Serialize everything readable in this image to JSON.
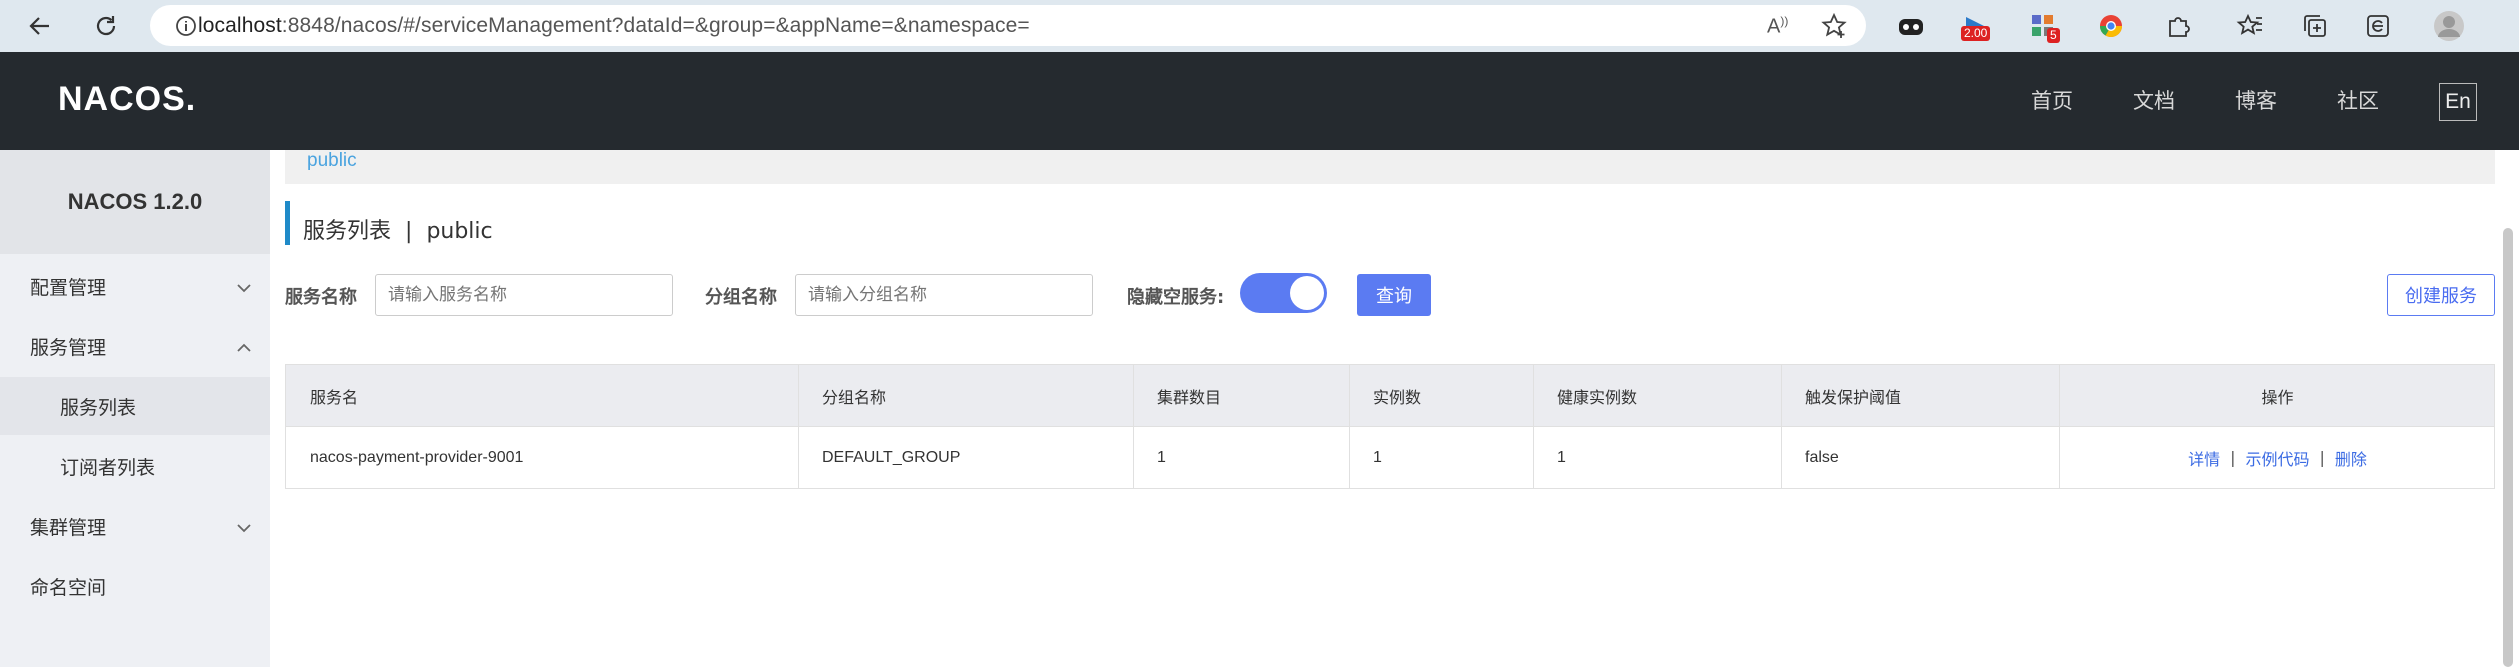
{
  "browser": {
    "url_host": "localhost",
    "url_rest": ":8848/nacos/#/serviceManagement?dataId=&group=&appName=&namespace=",
    "extensions": [
      {
        "name": "copilot-icon"
      },
      {
        "name": "extension-badge-icon",
        "badge": "2.00"
      },
      {
        "name": "extension-grid-icon",
        "badge": "5"
      },
      {
        "name": "chrome-like-icon"
      },
      {
        "name": "puzzle-icon"
      }
    ]
  },
  "header": {
    "logo": "NACOS.",
    "nav": [
      "首页",
      "文档",
      "博客",
      "社区"
    ],
    "lang": "En"
  },
  "sidebar": {
    "version": "NACOS 1.2.0",
    "items": [
      {
        "label": "配置管理",
        "chevron": "down"
      },
      {
        "label": "服务管理",
        "chevron": "up"
      },
      {
        "label": "服务列表",
        "sub": true
      },
      {
        "label": "订阅者列表",
        "sub": true
      },
      {
        "label": "集群管理",
        "chevron": "down"
      },
      {
        "label": "命名空间"
      }
    ]
  },
  "main": {
    "namespace_crumb": "public",
    "title": "服务列表",
    "title_sep": "|",
    "title_namespace": "public",
    "filters": {
      "service_label": "服务名称",
      "service_placeholder": "请输入服务名称",
      "group_label": "分组名称",
      "group_placeholder": "请输入分组名称",
      "hide_empty_label": "隐藏空服务:",
      "hide_empty_on": true,
      "query_button": "查询",
      "create_button": "创建服务"
    },
    "table": {
      "headers": [
        "服务名",
        "分组名称",
        "集群数目",
        "实例数",
        "健康实例数",
        "触发保护阈值",
        "操作"
      ],
      "rows": [
        {
          "service": "nacos-payment-provider-9001",
          "group": "DEFAULT_GROUP",
          "clusters": "1",
          "instances": "1",
          "healthy": "1",
          "threshold": "false",
          "ops": [
            "详情",
            "示例代码",
            "删除"
          ]
        }
      ]
    }
  }
}
